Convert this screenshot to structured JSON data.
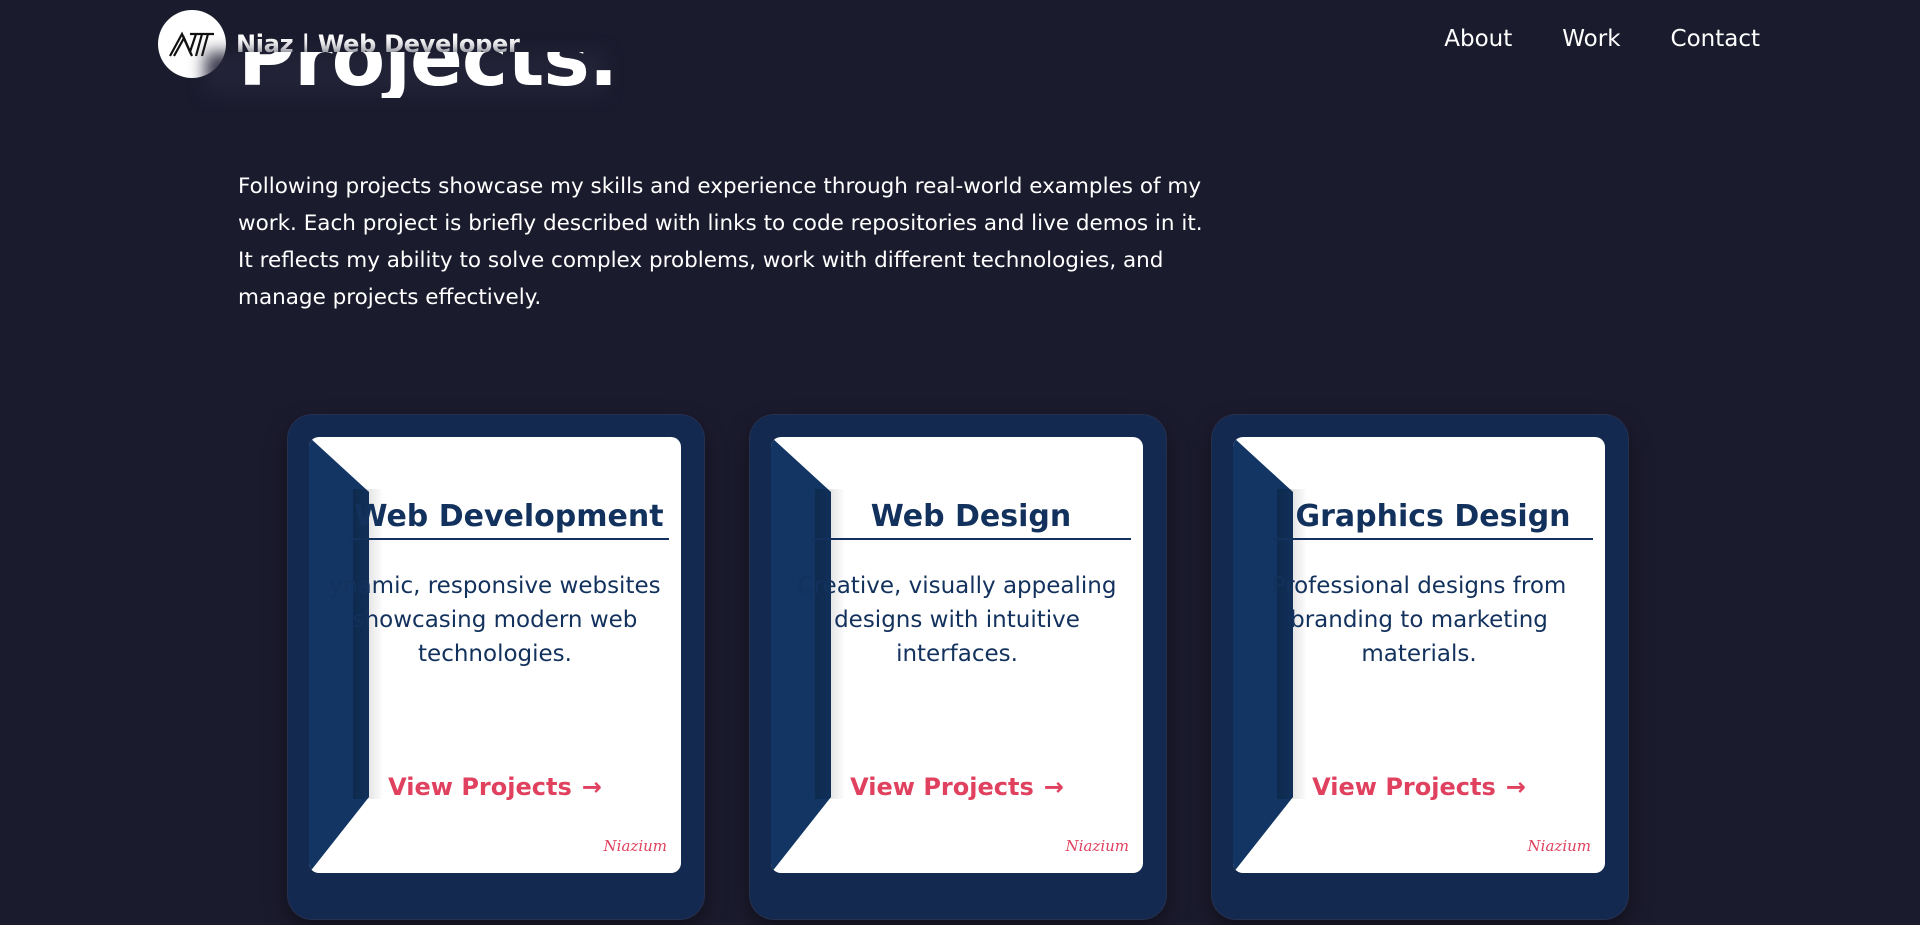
{
  "header": {
    "brand": "Niaz | Web Developer",
    "nav": [
      "About",
      "Work",
      "Contact"
    ]
  },
  "main": {
    "heading": "Projects.",
    "intro": "Following projects showcase my skills and experience through real-world examples of my work. Each project is briefly described with links to code repositories and live demos in it. It reflects my ability to solve complex problems, work with different technologies, and manage projects effectively."
  },
  "cards": [
    {
      "title": "Web Development",
      "desc": "ynamic, responsive websites showcasing modern web technologies.",
      "link": "View Projects",
      "signature": "Niazium"
    },
    {
      "title": "Web Design",
      "desc": "Creative, visually appealing designs with intuitive interfaces.",
      "link": "View Projects",
      "signature": "Niazium"
    },
    {
      "title": "Graphics Design",
      "desc": "Professional designs from branding to marketing materials.",
      "link": "View Projects",
      "signature": "Niazium"
    }
  ],
  "colors": {
    "background": "#1b1b2e",
    "card_frame": "#14294f",
    "card_text": "#12315c",
    "accent": "#e0415f"
  },
  "icons": {
    "logo": "niaz-monogram-logo",
    "arrow": "arrow-right-icon"
  }
}
